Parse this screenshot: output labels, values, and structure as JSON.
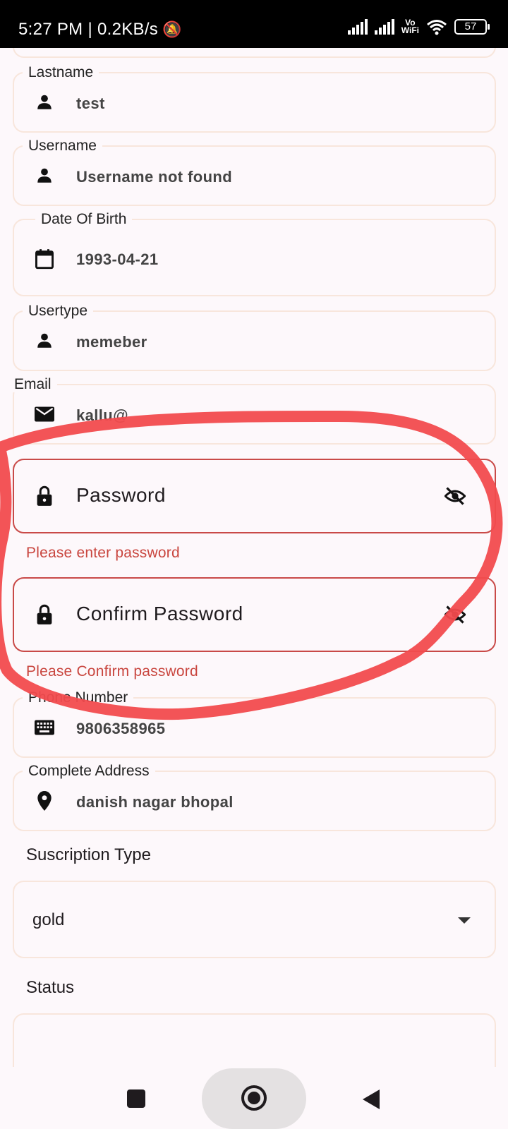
{
  "status_bar": {
    "time": "5:27 PM | 0.2KB/s",
    "battery": "57",
    "vowifi_top": "Vo",
    "vowifi_bottom": "WiFi"
  },
  "form": {
    "lastname": {
      "label": "Lastname",
      "value": "test",
      "icon": "person-icon"
    },
    "username": {
      "label": "Username",
      "value": "Username not found",
      "icon": "person-icon"
    },
    "dob": {
      "label": "Date Of Birth",
      "value": "1993-04-21",
      "icon": "calendar-icon"
    },
    "usertype": {
      "label": "Usertype",
      "value": "memeber",
      "icon": "person-icon"
    },
    "email": {
      "label": "Email",
      "value": "kallu@",
      "icon": "mail-icon"
    },
    "password": {
      "placeholder": "Password",
      "error": "Please enter password",
      "icon": "lock-icon",
      "toggle_icon": "eye-off-icon"
    },
    "confirm_password": {
      "placeholder": "Confirm Password",
      "error": "Please Confirm password",
      "icon": "lock-icon",
      "toggle_icon": "eye-off-icon"
    },
    "phone": {
      "label": "Phone Number",
      "value": "9806358965",
      "icon": "keyboard-icon"
    },
    "address": {
      "label": "Complete Address",
      "value": "danish nagar bhopal",
      "icon": "location-pin-icon"
    },
    "subscription": {
      "label": "Suscription Type",
      "value": "gold",
      "icon": "dropdown-arrow-icon"
    },
    "status": {
      "label": "Status"
    }
  },
  "colors": {
    "error": "#c9463f",
    "border": "#f8e6dc",
    "annotation": "#f24b4e",
    "background": "#fdf8fb"
  }
}
